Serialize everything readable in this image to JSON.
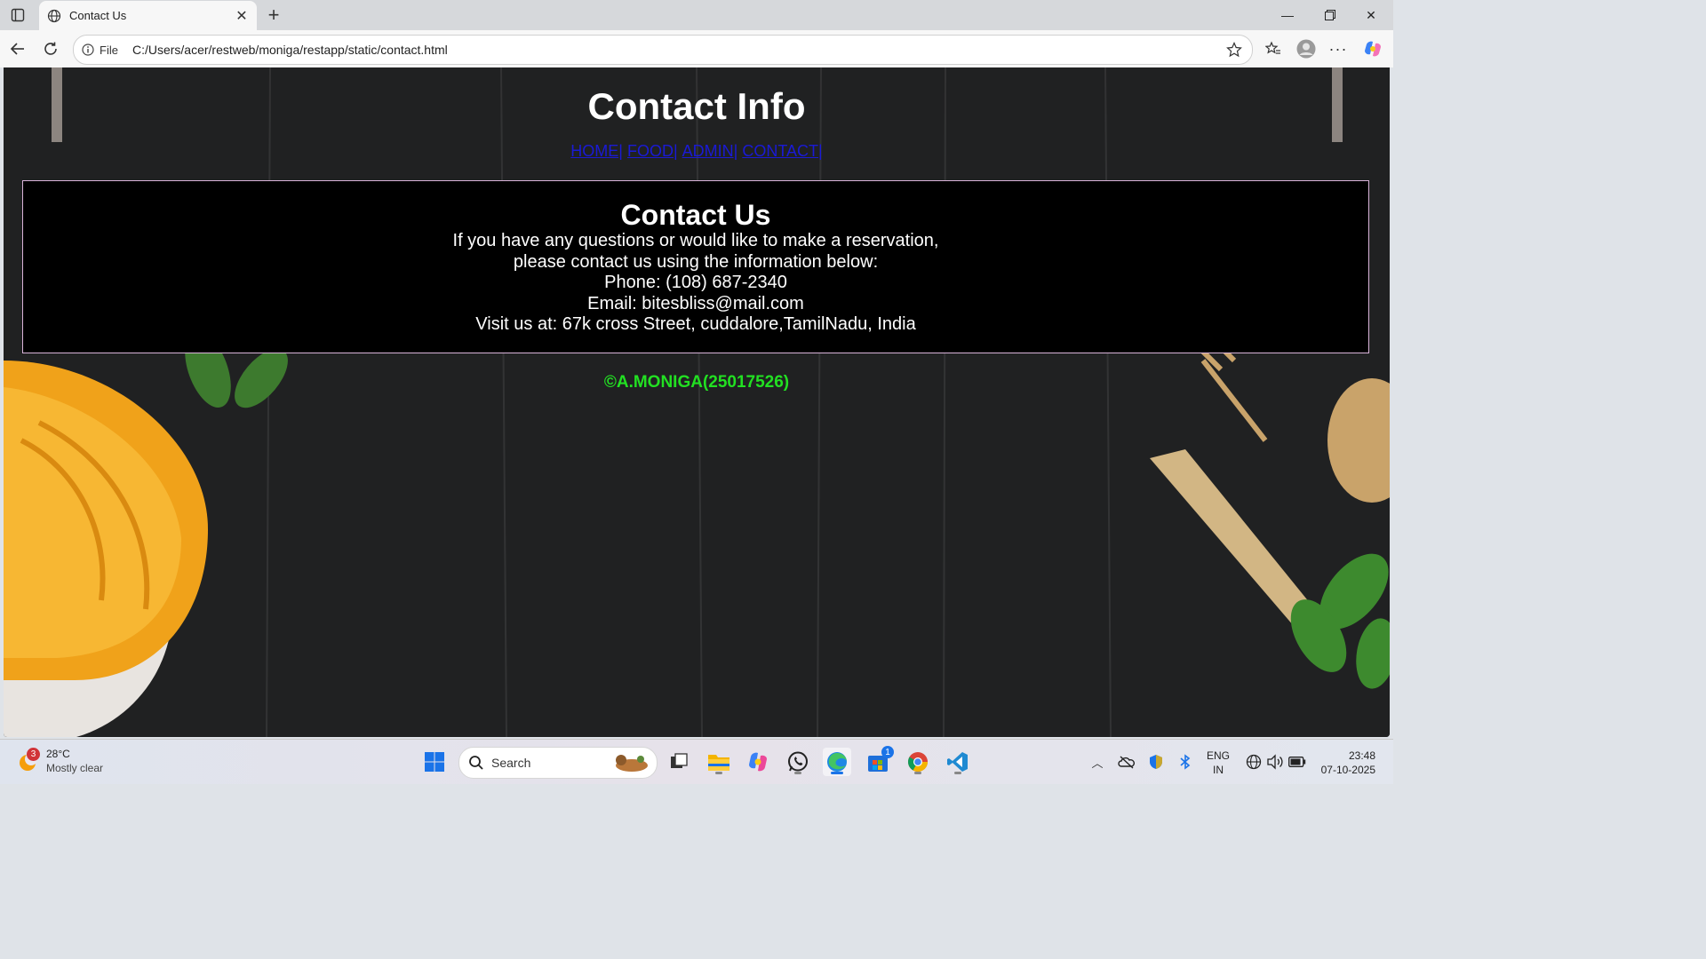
{
  "browser": {
    "tab": {
      "title": "Contact Us"
    },
    "address": {
      "scheme": "File",
      "url": "C:/Users/acer/restweb/moniga/restapp/static/contact.html"
    }
  },
  "page": {
    "title": "Contact Info",
    "nav": [
      {
        "label": "HOME|"
      },
      {
        "label": "FOOD|"
      },
      {
        "label": "ADMIN|"
      },
      {
        "label": "CONTACT|"
      }
    ],
    "contact": {
      "heading": "Contact Us",
      "lines": [
        "If you have any questions or would like to make a reservation,",
        "please contact us using the information below:",
        "Phone: (108) 687-2340",
        "Email: bitesbliss@mail.com",
        "Visit us at: 67k cross Street, cuddalore,TamilNadu, India"
      ]
    },
    "footer": "©A.MONIGA(25017526)",
    "colors": {
      "link": "#1a1ad6",
      "footer": "#22e022",
      "box_border": "#d9b3d9"
    }
  },
  "taskbar": {
    "weather": {
      "temp": "28°C",
      "condition": "Mostly clear",
      "badge": "3"
    },
    "search_label": "Search",
    "store_badge": "1",
    "lang": {
      "line1": "ENG",
      "line2": "IN"
    },
    "clock": {
      "time": "23:48",
      "date": "07-10-2025"
    },
    "icons": [
      "windows-start-icon",
      "task-view-icon",
      "file-explorer-icon",
      "copilot-icon",
      "whatsapp-icon",
      "edge-icon",
      "microsoft-store-icon",
      "chrome-icon",
      "vscode-icon"
    ]
  }
}
